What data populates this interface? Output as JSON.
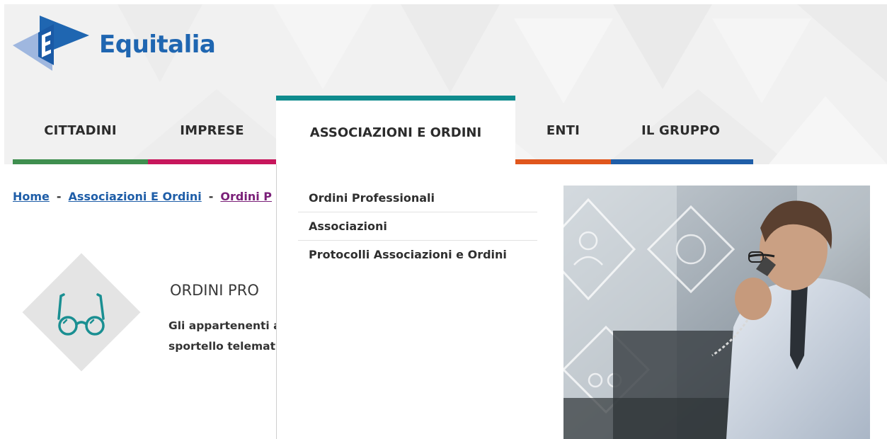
{
  "header": {
    "logo_text": "Equitalia",
    "logo_icon": "equitalia-e-icon"
  },
  "nav": {
    "items": [
      {
        "label": "CITTADINI",
        "color": "#3f8f4f"
      },
      {
        "label": "IMPRESE",
        "color": "#c7175c"
      },
      {
        "label": "ASSOCIAZIONI E ORDINI",
        "color": "#0f8b8d",
        "active": true
      },
      {
        "label": "ENTI",
        "color": "#e0561d"
      },
      {
        "label": "IL GRUPPO",
        "color": "#1f5ea8"
      }
    ]
  },
  "dropdown": {
    "items": [
      {
        "label": "Ordini Professionali"
      },
      {
        "label": "Associazioni"
      },
      {
        "label": "Protocolli Associazioni e Ordini"
      }
    ]
  },
  "breadcrumb": {
    "home": "Home",
    "separator": "-",
    "level1": "Associazioni E Ordini",
    "level2": "Ordini P"
  },
  "section": {
    "icon": "glasses-icon",
    "title": "ORDINI PRO",
    "desc_line1": "Gli appartenenti a",
    "desc_line2": "sportello telemati"
  },
  "colors": {
    "brand_blue": "#1f66b1",
    "teal": "#0f8b8d",
    "link": "#1f5ea8",
    "visited": "#7a1f78"
  }
}
